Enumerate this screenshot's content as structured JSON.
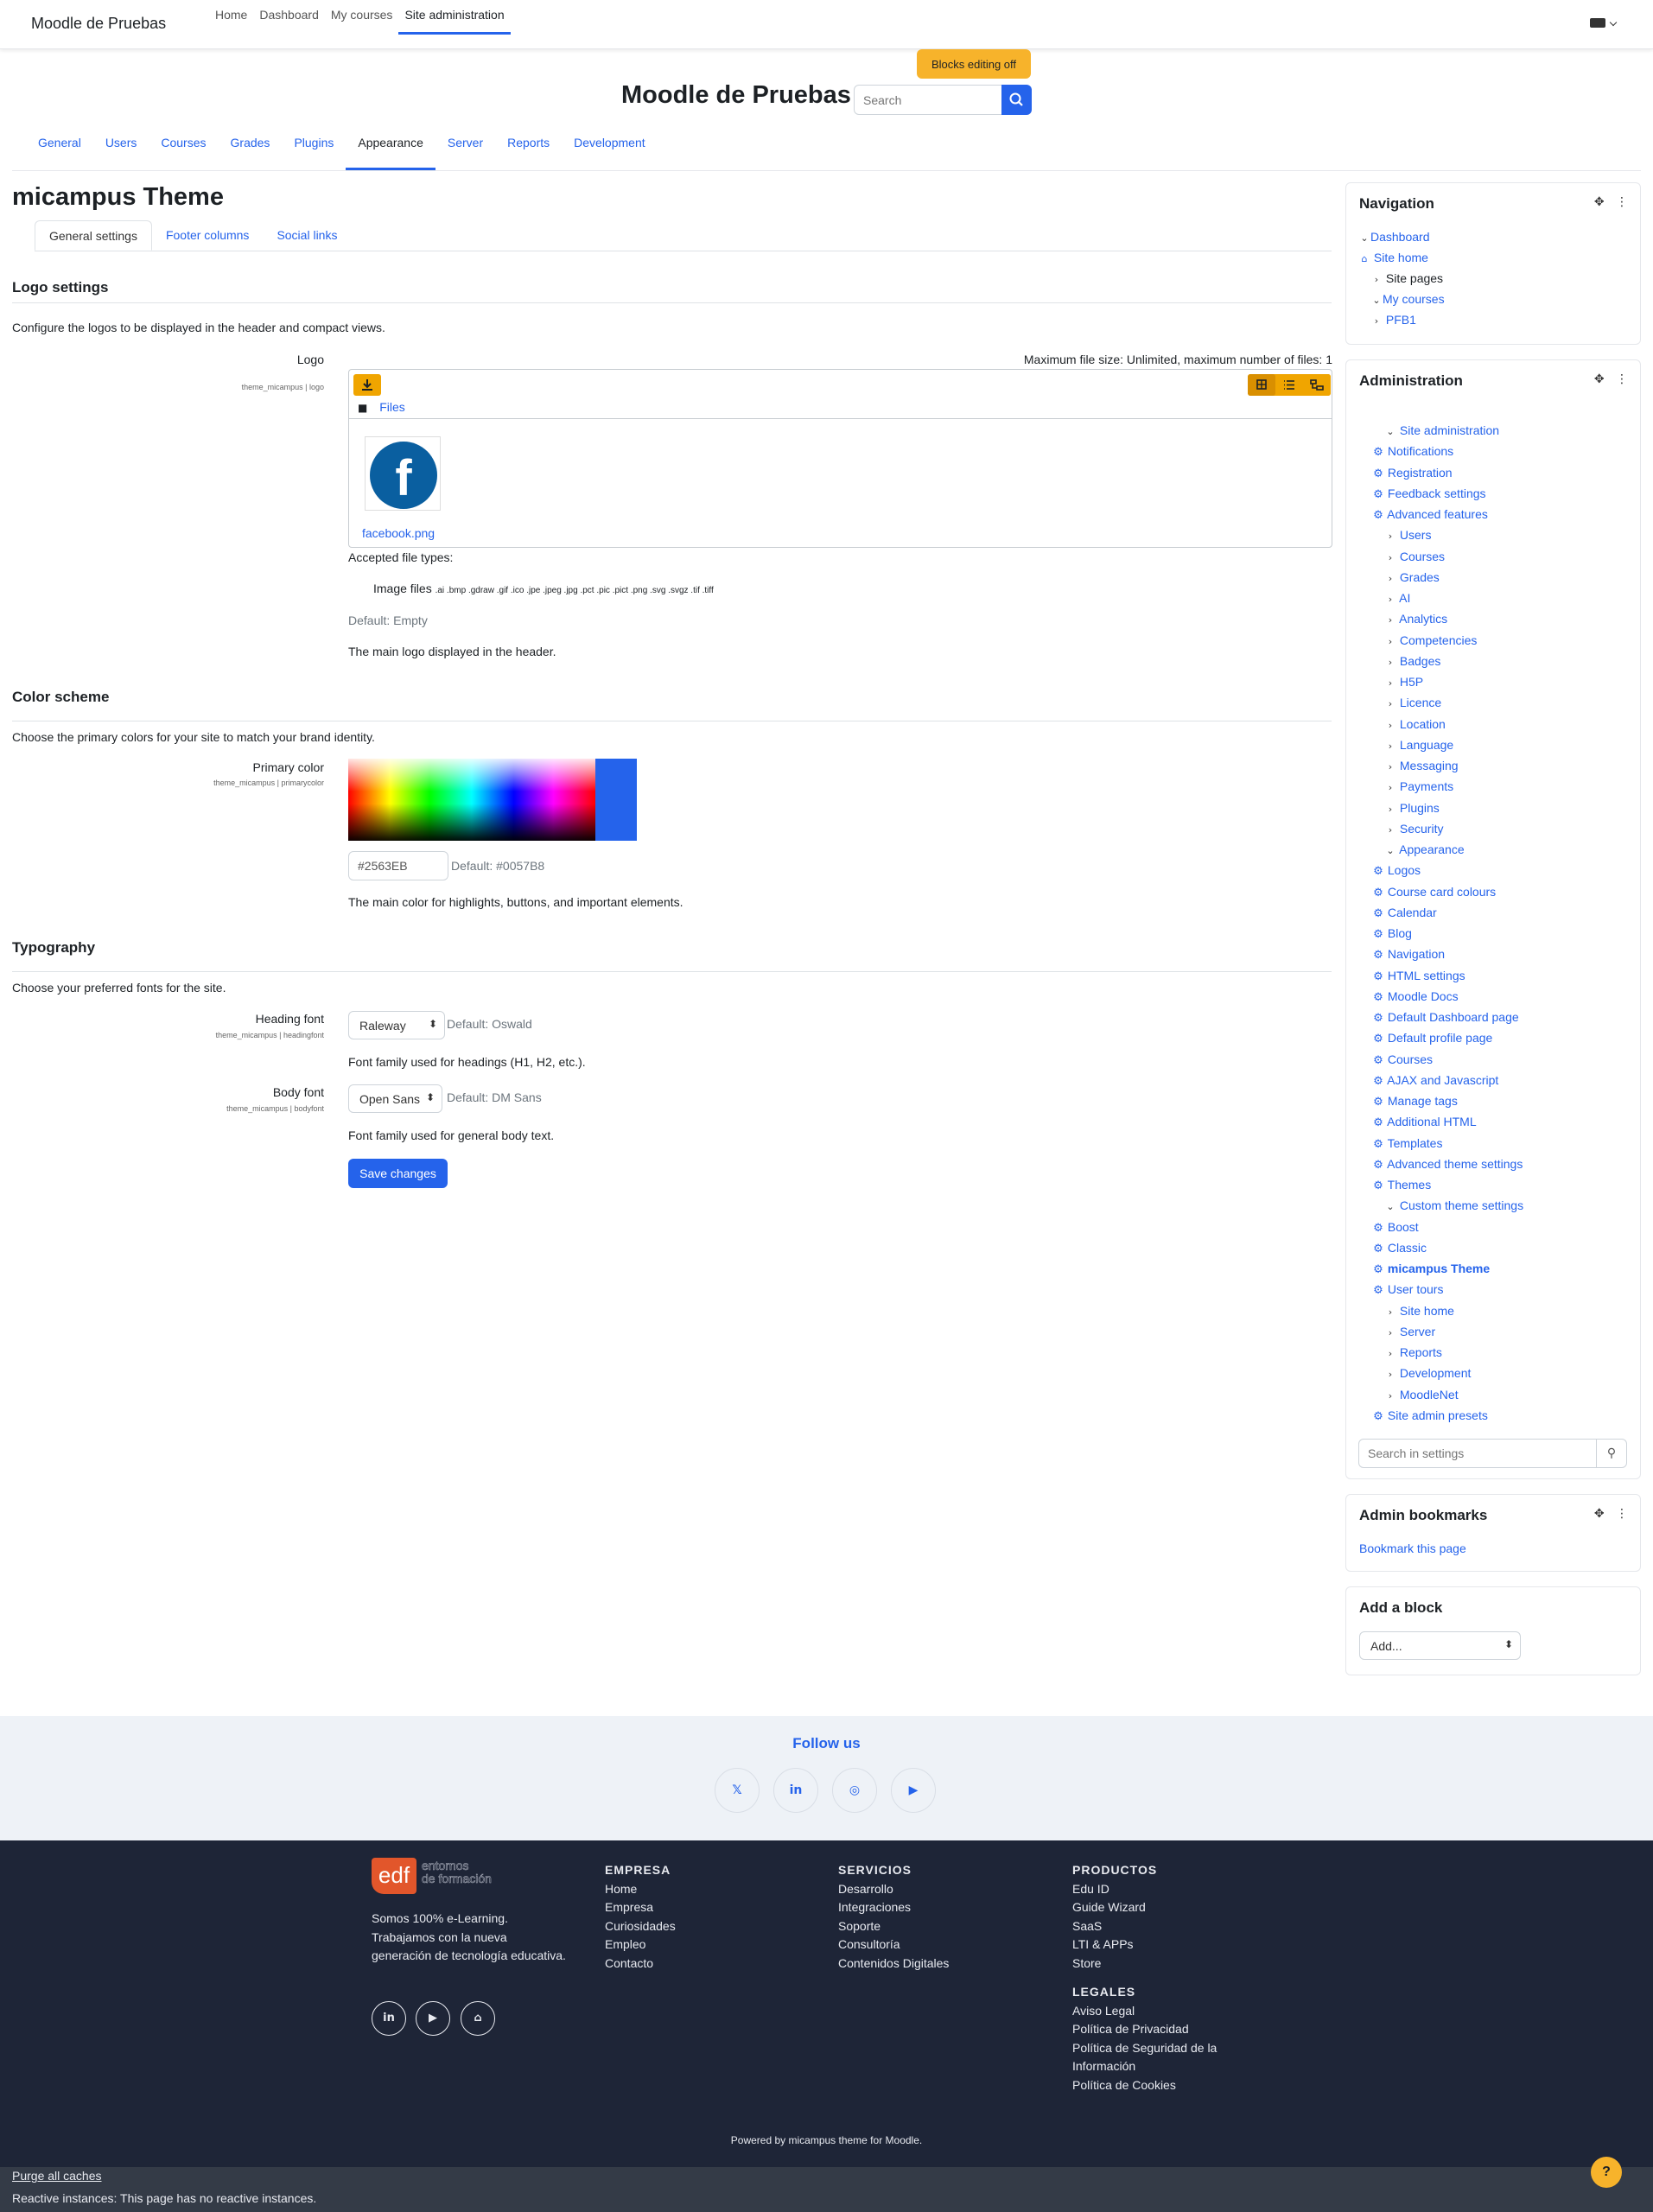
{
  "topbar": {
    "brand": "Moodle de Pruebas",
    "nav": [
      "Home",
      "Dashboard",
      "My courses",
      "Site administration"
    ]
  },
  "edit_toggle": "Blocks editing off",
  "site_title": "Moodle de Pruebas",
  "search": {
    "placeholder": "Search"
  },
  "admin_tabs": [
    "General",
    "Users",
    "Courses",
    "Grades",
    "Plugins",
    "Appearance",
    "Server",
    "Reports",
    "Development"
  ],
  "page": {
    "title": "micampus Theme",
    "tabs": [
      "General settings",
      "Footer columns",
      "Social links"
    ],
    "logo_section": {
      "heading": "Logo settings",
      "desc": "Configure the logos to be displayed in the header and compact views.",
      "label": "Logo",
      "setting": "theme_micampus | logo",
      "limits": "Maximum file size: Unlimited, maximum number of files: 1",
      "folder": "Files",
      "file": "facebook.png",
      "accepted_title": "Accepted file types:",
      "image_files": "Image files",
      "extensions": ".ai .bmp .gdraw .gif .ico .jpe .jpeg .jpg .pct .pic .pict .png .svg .svgz .tif .tiff",
      "default": "Default: Empty",
      "help": "The main logo displayed in the header."
    },
    "color_section": {
      "heading": "Color scheme",
      "desc": "Choose the primary colors for your site to match your brand identity.",
      "label": "Primary color",
      "setting": "theme_micampus | primarycolor",
      "value": "#2563EB",
      "default": "Default: #0057B8",
      "help": "The main color for highlights, buttons, and important elements.",
      "swatch_color": "#2563eb"
    },
    "typo_section": {
      "heading": "Typography",
      "desc": "Choose your preferred fonts for the site.",
      "heading_font": {
        "label": "Heading font",
        "setting": "theme_micampus | headingfont",
        "value": "Raleway",
        "default": "Default: Oswald",
        "help": "Font family used for headings (H1, H2, etc.)."
      },
      "body_font": {
        "label": "Body font",
        "setting": "theme_micampus | bodyfont",
        "value": "Open Sans",
        "default": "Default: DM Sans",
        "help": "Font family used for general body text."
      }
    },
    "save": "Save changes"
  },
  "navigation": {
    "title": "Navigation",
    "items": [
      "Dashboard",
      "Site home",
      "Site pages",
      "My courses",
      "PFB1"
    ]
  },
  "administration": {
    "title": "Administration",
    "items": [
      "Site administration",
      "Notifications",
      "Registration",
      "Feedback settings",
      "Advanced features",
      "Users",
      "Courses",
      "Grades",
      "AI",
      "Analytics",
      "Competencies",
      "Badges",
      "H5P",
      "Licence",
      "Location",
      "Language",
      "Messaging",
      "Payments",
      "Plugins",
      "Security",
      "Appearance",
      "Logos",
      "Course card colours",
      "Calendar",
      "Blog",
      "Navigation",
      "HTML settings",
      "Moodle Docs",
      "Default Dashboard page",
      "Default profile page",
      "Courses",
      "AJAX and Javascript",
      "Manage tags",
      "Additional HTML",
      "Templates",
      "Advanced theme settings",
      "Themes",
      "Custom theme settings",
      "Boost",
      "Classic",
      "micampus Theme",
      "User tours",
      "Site home",
      "Server",
      "Reports",
      "Development",
      "MoodleNet",
      "Site admin presets"
    ],
    "search_placeholder": "Search in settings"
  },
  "bookmarks": {
    "title": "Admin bookmarks",
    "link": "Bookmark this page"
  },
  "add_block": {
    "title": "Add a block",
    "select": "Add..."
  },
  "follow": {
    "title": "Follow us"
  },
  "footer": {
    "logo_mark": "edf",
    "logo_text_1": "entornos",
    "logo_text_2": "de formación",
    "about": [
      "Somos 100% e-Learning.",
      "Trabajamos con la nueva",
      "generación de tecnología educativa."
    ],
    "empresa": {
      "title": "EMPRESA",
      "links": [
        "Home",
        "Empresa",
        "Curiosidades",
        "Empleo",
        "Contacto"
      ]
    },
    "servicios": {
      "title": "SERVICIOS",
      "links": [
        "Desarrollo",
        "Integraciones",
        "Soporte",
        "Consultoría",
        "Contenidos Digitales"
      ]
    },
    "productos": {
      "title": "PRODUCTOS",
      "links": [
        "Edu ID",
        "Guide Wizard",
        "SaaS",
        "LTI & APPs",
        "Store"
      ]
    },
    "legales": {
      "title": "LEGALES",
      "links": [
        "Aviso Legal",
        "Política de Privacidad",
        "Política de Seguridad de la Información",
        "Política de Cookies"
      ]
    },
    "powered": "Powered by micampus theme for Moodle."
  },
  "bottom": {
    "purge": "Purge all caches",
    "reactive": "Reactive instances: This page has no reactive instances."
  },
  "colors": {
    "accent": "#2563eb",
    "warning": "#f7b32b",
    "footer_bg": "#1e2537"
  }
}
